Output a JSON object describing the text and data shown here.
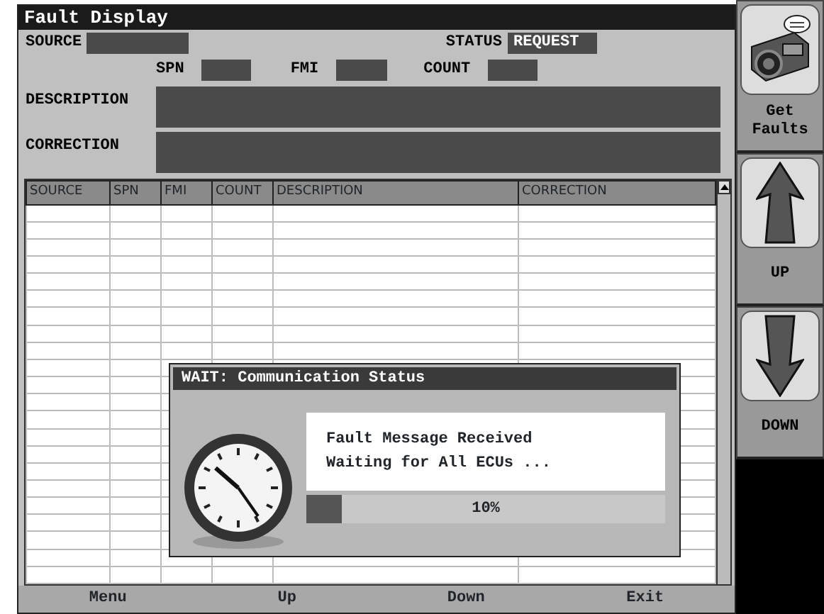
{
  "window": {
    "title": "Fault Display"
  },
  "fields": {
    "source": {
      "label": "SOURCE"
    },
    "status": {
      "label": "STATUS",
      "value": "REQUEST"
    },
    "spn": {
      "label": "SPN"
    },
    "fmi": {
      "label": "FMI"
    },
    "count": {
      "label": "COUNT"
    },
    "description": {
      "label": "DESCRIPTION"
    },
    "correction": {
      "label": "CORRECTION"
    }
  },
  "table": {
    "columns": [
      "SOURCE",
      "SPN",
      "FMI",
      "COUNT",
      "DESCRIPTION",
      "CORRECTION"
    ]
  },
  "dialog": {
    "title": "WAIT: Communication Status",
    "message_lines": [
      "Fault Message Received",
      "Waiting for All ECUs ..."
    ],
    "progress": {
      "level": 0.1,
      "reading": "10%"
    }
  },
  "side_buttons": [
    {
      "kind": "faults",
      "label": "Get Faults"
    },
    {
      "kind": "up",
      "label": "UP"
    },
    {
      "kind": "down",
      "label": "DOWN"
    }
  ],
  "bottom_bar": [
    "Menu",
    "Up",
    "Down",
    "Exit"
  ]
}
